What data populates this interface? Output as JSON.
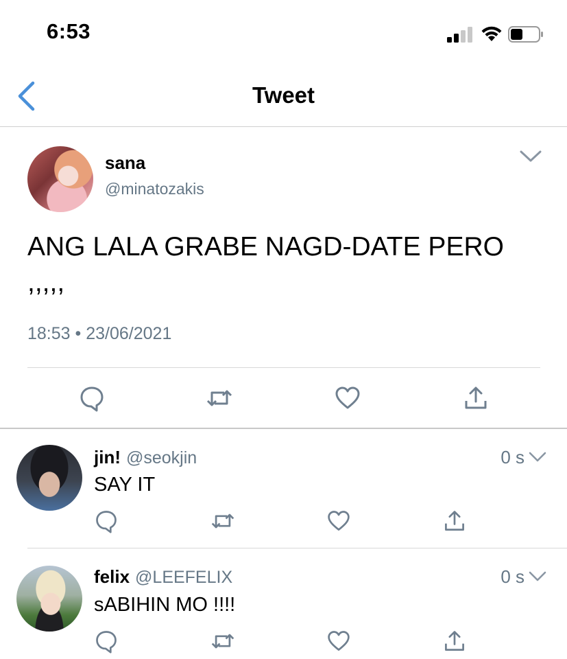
{
  "status_bar": {
    "time": "6:53"
  },
  "nav": {
    "title": "Tweet"
  },
  "main_tweet": {
    "name": "sana",
    "handle": "@minatozakis",
    "text": "ANG LALA GRABE NAGD-DATE PERO ,,,,,",
    "time": "18:53",
    "separator": "•",
    "date": "23/06/2021"
  },
  "replies": [
    {
      "name": "jin!",
      "handle": "@seokjin",
      "time": "0 s",
      "text": "SAY IT"
    },
    {
      "name": "felix",
      "handle": "@LEEFELIX",
      "time": "0 s",
      "text": "sABIHIN MO !!!!"
    }
  ],
  "colors": {
    "accent": "#4a90d9",
    "secondary_text": "#657786",
    "icon": "#6f7f8f"
  },
  "icons": [
    "back-icon",
    "chevron-down-icon",
    "reply-icon",
    "retweet-icon",
    "like-icon",
    "share-icon"
  ]
}
